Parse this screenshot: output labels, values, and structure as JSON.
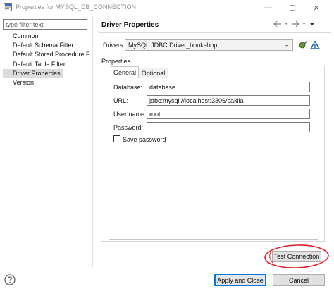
{
  "window": {
    "title": "Properties for MYSQL_DB_CONNECTION",
    "minimize_glyph": "—",
    "maximize_glyph": "☐",
    "close_glyph": "✕"
  },
  "filter": {
    "placeholder": "type filter text",
    "value": ""
  },
  "nav": {
    "items": [
      {
        "label": "Common"
      },
      {
        "label": "Default Schema Filter"
      },
      {
        "label": "Default Stored Procedure Fi"
      },
      {
        "label": "Default Table Filter"
      },
      {
        "label": "Driver Properties",
        "selected": true
      },
      {
        "label": "Version"
      }
    ]
  },
  "page": {
    "title": "Driver Properties",
    "nav_icons": [
      "back-arrow-icon",
      "back-dropdown-icon",
      "forward-arrow-icon",
      "forward-dropdown-icon",
      "view-menu-icon"
    ]
  },
  "drivers": {
    "label": "Drivers:",
    "selected": "MySQL JDBC Driver_bookshop",
    "icons": [
      "edit-driver-icon",
      "driver-warning-icon"
    ]
  },
  "properties": {
    "group_label": "Properties",
    "tabs": [
      {
        "label": "General",
        "active": true
      },
      {
        "label": "Optional",
        "active": false
      }
    ],
    "fields": {
      "database": {
        "label": "Database:",
        "value": "database"
      },
      "url": {
        "label": "URL:",
        "value": "jdbc:mysql://localhost:3306/sakila"
      },
      "user": {
        "label": "User name:",
        "value": "root"
      },
      "password": {
        "label": "Password:",
        "value": ""
      }
    },
    "save_password": {
      "label": "Save password",
      "checked": false
    }
  },
  "buttons": {
    "test_connection": "Test Connection",
    "apply_close": "Apply and Close",
    "cancel": "Cancel"
  },
  "colors": {
    "highlight_oval": "#d9232d",
    "focus_border": "#0078d7",
    "selection": "#dcdcdc"
  }
}
